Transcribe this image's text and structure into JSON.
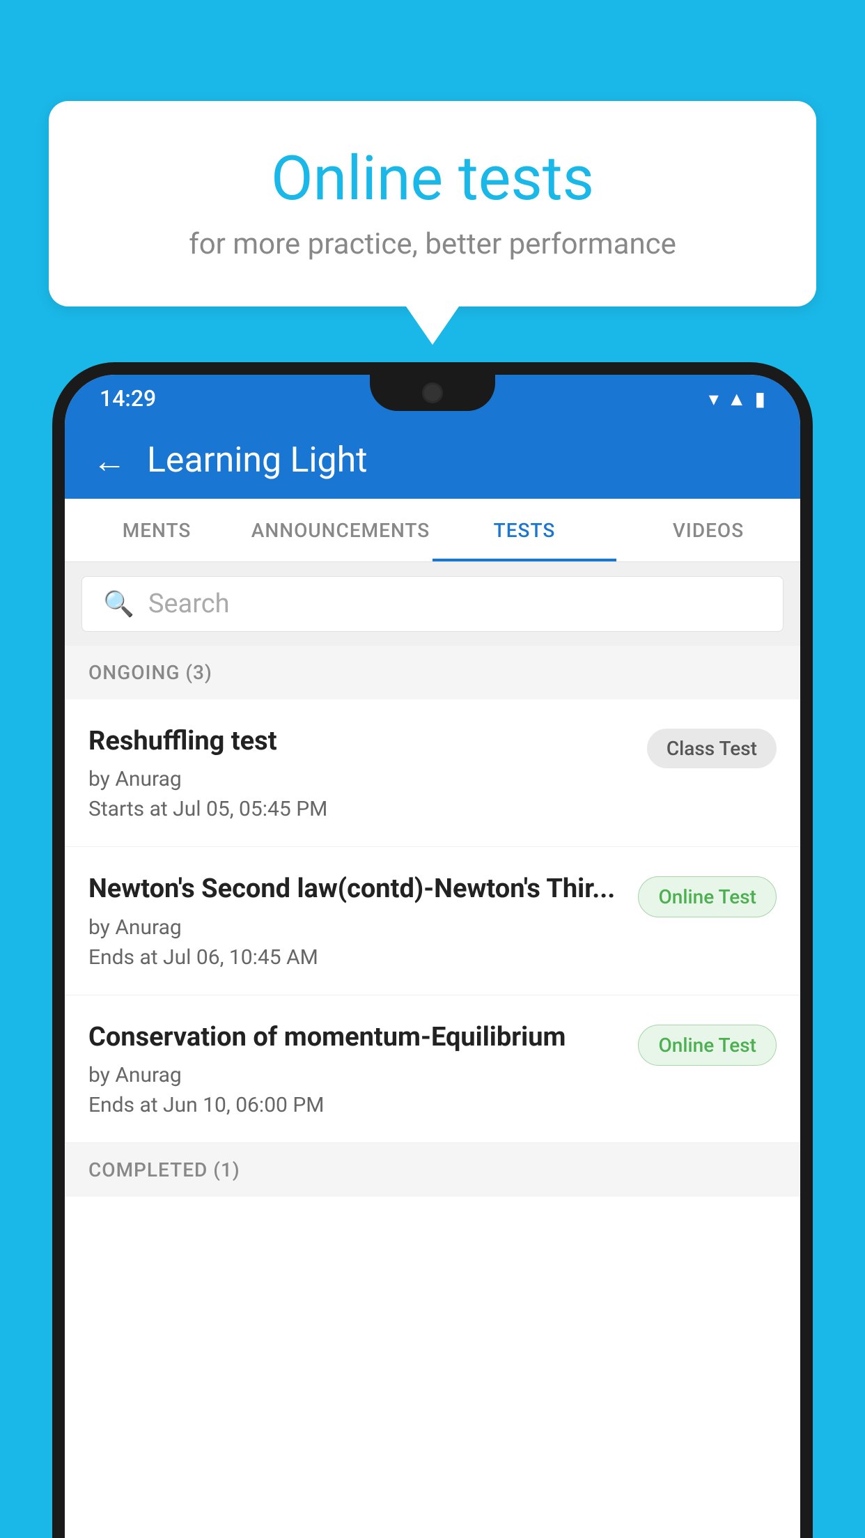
{
  "background_color": "#1ab8e8",
  "speech_bubble": {
    "title": "Online tests",
    "subtitle": "for more practice, better performance"
  },
  "status_bar": {
    "time": "14:29",
    "icons": [
      "wifi",
      "signal",
      "battery"
    ]
  },
  "app_bar": {
    "back_label": "←",
    "title": "Learning Light"
  },
  "tabs": [
    {
      "label": "MENTS",
      "active": false
    },
    {
      "label": "ANNOUNCEMENTS",
      "active": false
    },
    {
      "label": "TESTS",
      "active": true
    },
    {
      "label": "VIDEOS",
      "active": false
    }
  ],
  "search": {
    "placeholder": "Search"
  },
  "ongoing_section": {
    "label": "ONGOING (3)"
  },
  "tests": [
    {
      "title": "Reshuffling test",
      "author": "by Anurag",
      "time": "Starts at  Jul 05, 05:45 PM",
      "badge": "Class Test",
      "badge_type": "class"
    },
    {
      "title": "Newton's Second law(contd)-Newton's Thir...",
      "author": "by Anurag",
      "time": "Ends at  Jul 06, 10:45 AM",
      "badge": "Online Test",
      "badge_type": "online"
    },
    {
      "title": "Conservation of momentum-Equilibrium",
      "author": "by Anurag",
      "time": "Ends at  Jun 10, 06:00 PM",
      "badge": "Online Test",
      "badge_type": "online"
    }
  ],
  "completed_section": {
    "label": "COMPLETED (1)"
  }
}
